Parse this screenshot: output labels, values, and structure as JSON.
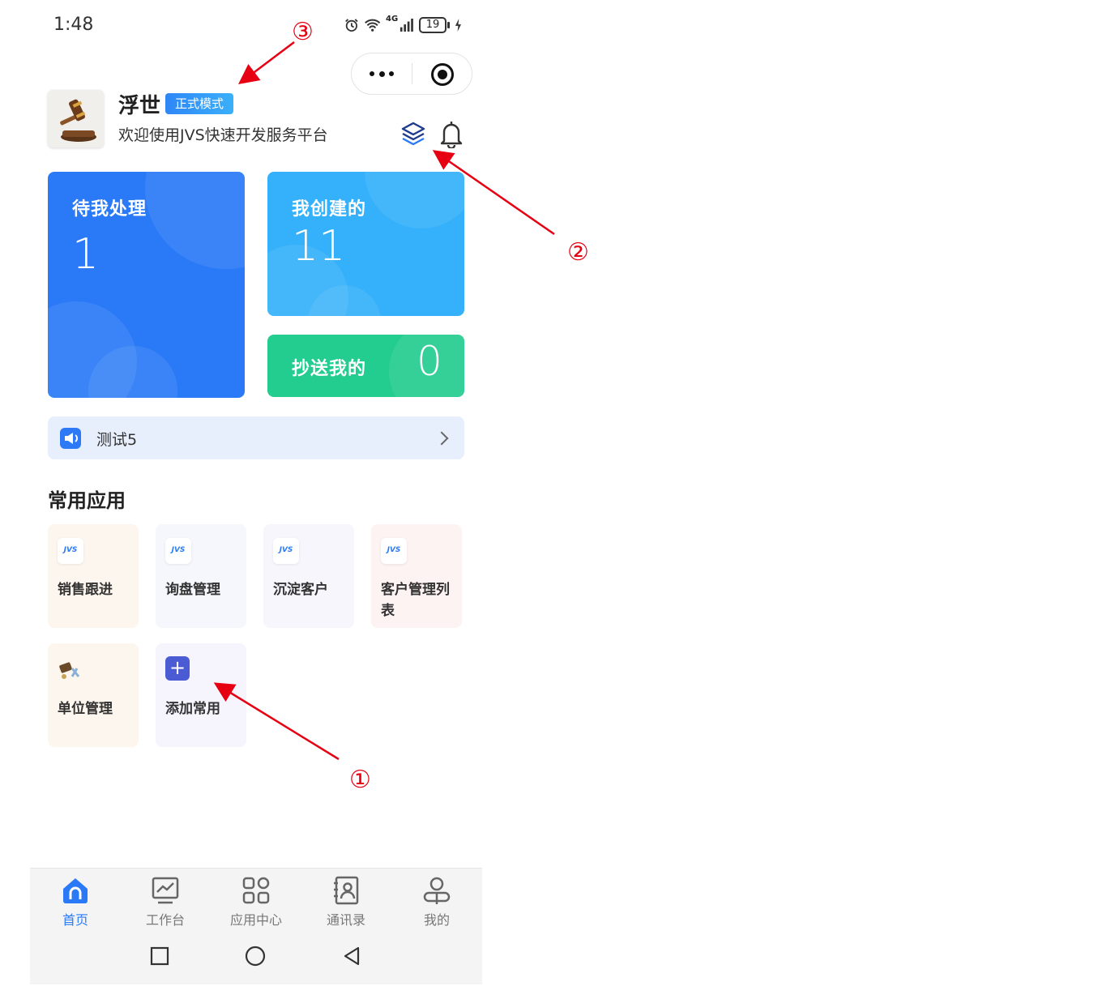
{
  "status_bar": {
    "time": "1:48",
    "network": "4G",
    "battery": "19"
  },
  "profile": {
    "name": "浮世",
    "mode_badge": "正式模式",
    "welcome": "欢迎使用JVS快速开发服务平台"
  },
  "cards": {
    "todo": {
      "label": "待我处理",
      "count": "1"
    },
    "created": {
      "label": "我创建的",
      "count": "11"
    },
    "cc": {
      "label": "抄送我的",
      "count": "0"
    }
  },
  "notice": {
    "text": "测试5"
  },
  "common_apps": {
    "title": "常用应用",
    "items": [
      {
        "label": "销售跟进",
        "icon": "jvs-logo-icon",
        "icon_text": "JVS",
        "bg": "#fdf6ee"
      },
      {
        "label": "询盘管理",
        "icon": "jvs-logo-icon",
        "icon_text": "JVS",
        "bg": "#f6f7fd"
      },
      {
        "label": "沉淀客户",
        "icon": "jvs-logo-icon",
        "icon_text": "JVS",
        "bg": "#f7f6fd"
      },
      {
        "label": "客户管理列表",
        "icon": "jvs-logo-icon",
        "icon_text": "JVS",
        "bg": "#fdf3f2"
      },
      {
        "label": "单位管理",
        "icon": "unit-app-icon",
        "icon_text": "",
        "bg": "#fdf6ee"
      },
      {
        "label": "添加常用",
        "icon": "plus-icon",
        "icon_text": "+",
        "bg": "#f6f5fd"
      }
    ]
  },
  "tabbar": {
    "tabs": [
      {
        "label": "首页",
        "icon": "home-icon",
        "active": true
      },
      {
        "label": "工作台",
        "icon": "dashboard-icon",
        "active": false
      },
      {
        "label": "应用中心",
        "icon": "apps-grid-icon",
        "active": false
      },
      {
        "label": "通讯录",
        "icon": "contacts-icon",
        "active": false
      },
      {
        "label": "我的",
        "icon": "profile-icon",
        "active": false
      }
    ]
  },
  "annotations": {
    "one": "①",
    "two": "②",
    "three": "③"
  },
  "colors": {
    "accent": "#2a7af7",
    "created": "#35b0fa",
    "cc": "#23cd8f",
    "annotation": "#e60012"
  }
}
